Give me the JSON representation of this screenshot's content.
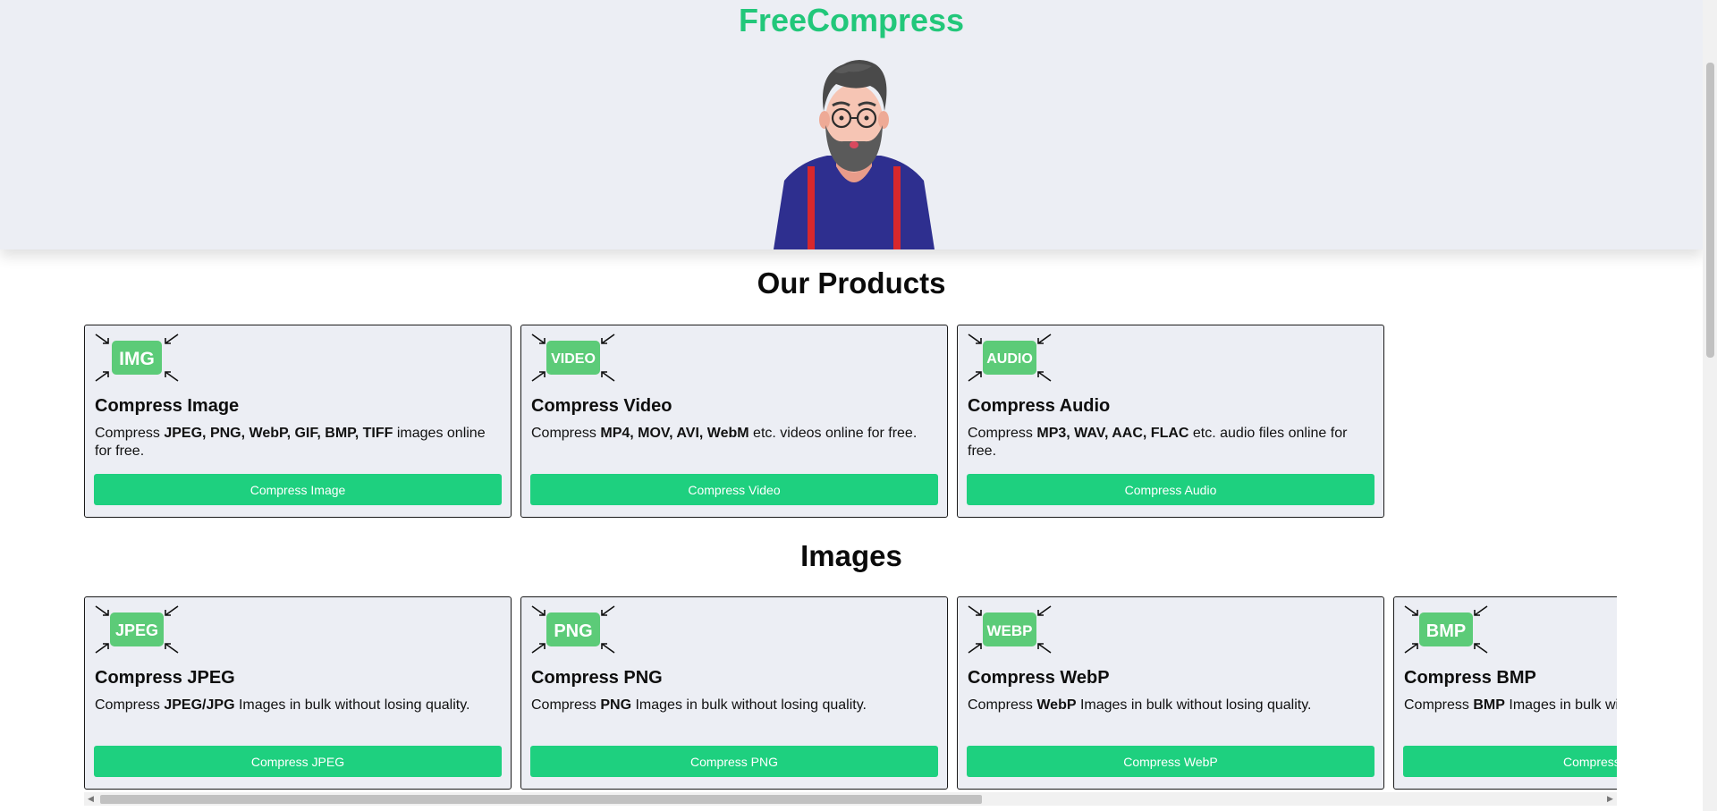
{
  "hero": {
    "brand": "FreeCompress"
  },
  "products": {
    "title": "Our Products",
    "cards": [
      {
        "icon_text": "IMG",
        "title": "Compress Image",
        "desc_prefix": "Compress ",
        "desc_bold": "JPEG, PNG, WebP, GIF, BMP, TIFF",
        "desc_suffix": " images online for free.",
        "button": "Compress Image"
      },
      {
        "icon_text": "VIDEO",
        "title": "Compress Video",
        "desc_prefix": "Compress ",
        "desc_bold": "MP4, MOV, AVI, WebM",
        "desc_suffix": " etc. videos online for free.",
        "button": "Compress Video"
      },
      {
        "icon_text": "AUDIO",
        "title": "Compress Audio",
        "desc_prefix": "Compress ",
        "desc_bold": "MP3, WAV, AAC, FLAC",
        "desc_suffix": " etc. audio files online for free.",
        "button": "Compress Audio"
      }
    ]
  },
  "images": {
    "title": "Images",
    "cards": [
      {
        "icon_text": "JPEG",
        "title": "Compress JPEG",
        "desc_prefix": "Compress ",
        "desc_bold": "JPEG/JPG",
        "desc_suffix": " Images in bulk without losing quality.",
        "button": "Compress JPEG"
      },
      {
        "icon_text": "PNG",
        "title": "Compress PNG",
        "desc_prefix": "Compress ",
        "desc_bold": "PNG",
        "desc_suffix": " Images in bulk without losing quality.",
        "button": "Compress PNG"
      },
      {
        "icon_text": "WEBP",
        "title": "Compress WebP",
        "desc_prefix": "Compress ",
        "desc_bold": "WebP",
        "desc_suffix": " Images in bulk without losing quality.",
        "button": "Compress WebP"
      },
      {
        "icon_text": "BMP",
        "title": "Compress BMP",
        "desc_prefix": "Compress ",
        "desc_bold": "BMP",
        "desc_suffix": " Images in bulk without losing quality.",
        "button": "Compress BMP"
      }
    ]
  },
  "colors": {
    "accent": "#1ed07f",
    "brand": "#22c77a",
    "card_bg": "#eceef4",
    "hero_bg": "#eceef4"
  },
  "icons": [
    "compress-arrows-icon",
    "scroll-left-arrow-icon",
    "scroll-right-arrow-icon"
  ]
}
